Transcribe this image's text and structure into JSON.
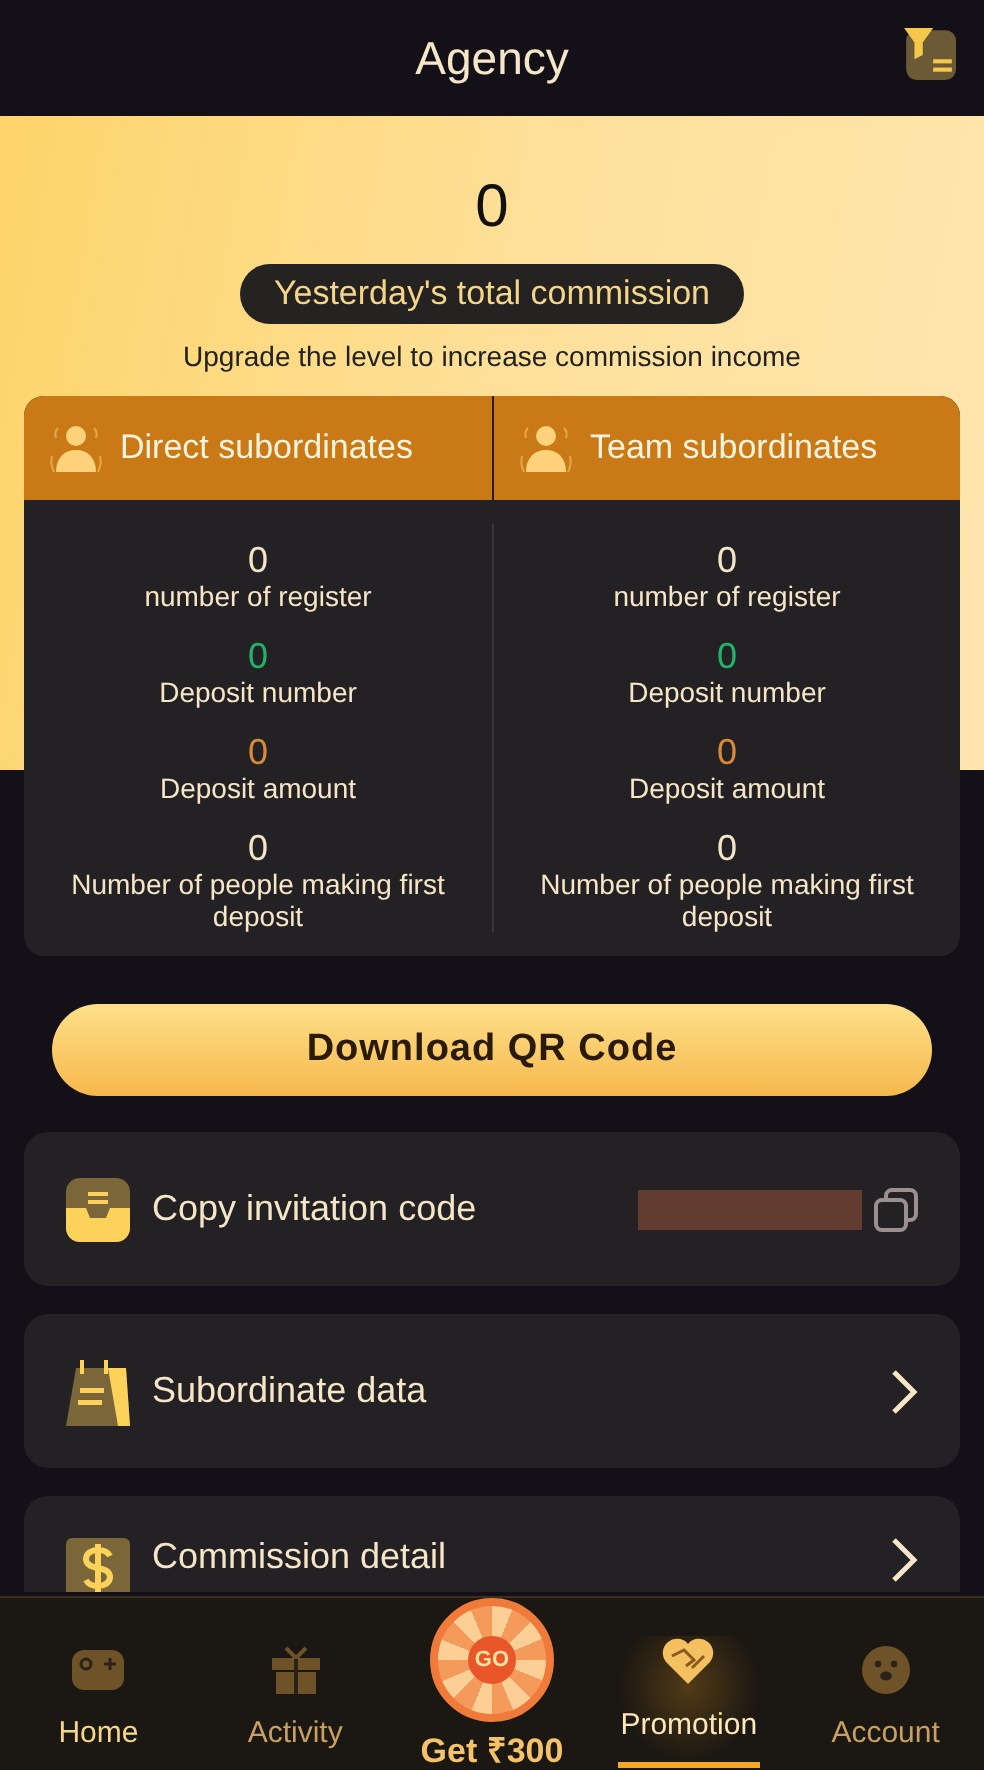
{
  "header": {
    "title": "Agency"
  },
  "summary": {
    "amount": "0",
    "label": "Yesterday's total commission",
    "note": "Upgrade the level to increase commission income"
  },
  "panels": [
    {
      "title": "Direct subordinates",
      "stats": [
        {
          "value": "0",
          "label": "number of register",
          "color": "#f5e6c8"
        },
        {
          "value": "0",
          "label": "Deposit number",
          "color": "#22b36b"
        },
        {
          "value": "0",
          "label": "Deposit amount",
          "color": "#d8893a"
        },
        {
          "value": "0",
          "label": "Number of people making first deposit",
          "color": "#f5e6c8"
        }
      ]
    },
    {
      "title": "Team subordinates",
      "stats": [
        {
          "value": "0",
          "label": "number of register",
          "color": "#f5e6c8"
        },
        {
          "value": "0",
          "label": "Deposit number",
          "color": "#22b36b"
        },
        {
          "value": "0",
          "label": "Deposit amount",
          "color": "#d8893a"
        },
        {
          "value": "0",
          "label": "Number of people making first deposit",
          "color": "#f5e6c8"
        }
      ]
    }
  ],
  "download_button": "Download QR Code",
  "menu": [
    {
      "kind": "copy",
      "label": "Copy invitation code"
    },
    {
      "kind": "link",
      "label": "Subordinate data"
    },
    {
      "kind": "link",
      "label": "Commission detail"
    }
  ],
  "nav": [
    {
      "kind": "tab",
      "label": "Home",
      "selected": false
    },
    {
      "kind": "tab",
      "label": "Activity",
      "selected": false
    },
    {
      "kind": "wheel",
      "label": "Get ₹300",
      "badge": "GO",
      "selected": false
    },
    {
      "kind": "tab",
      "label": "Promotion",
      "selected": true
    },
    {
      "kind": "tab",
      "label": "Account",
      "selected": false
    }
  ]
}
